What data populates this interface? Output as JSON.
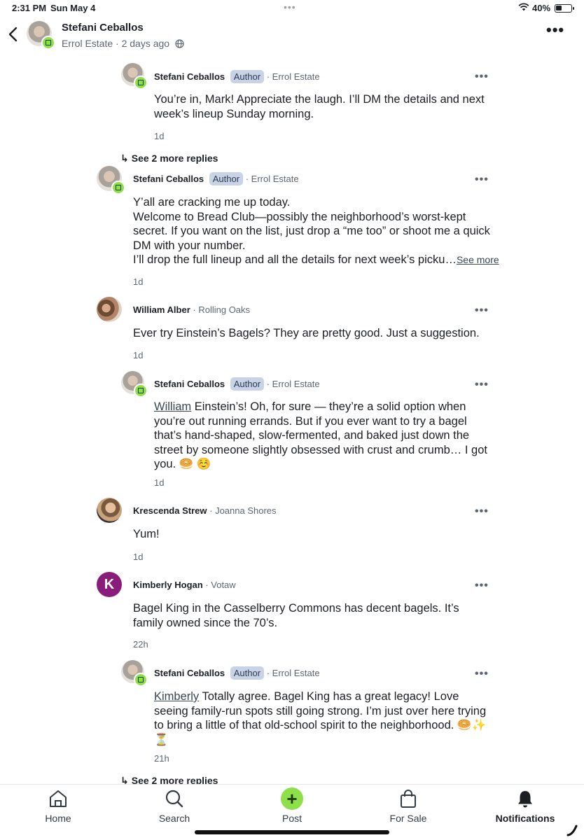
{
  "status_bar": {
    "time": "2:31 PM",
    "date": "Sun May 4",
    "battery": "40%",
    "battery_level": 0.4
  },
  "header": {
    "name": "Stefani Ceballos",
    "neighborhood": "Errol Estate",
    "age": "2 days ago"
  },
  "author_label": "Author",
  "comments": [
    {
      "name": "Stefani Ceballos",
      "location": "Errol Estate",
      "author": true,
      "mention": "",
      "text": "You’re in, Mark! Appreciate the laugh. I’ll DM the details and next week’s lineup Sunday morning.",
      "time": "1d"
    },
    {
      "name": "Stefani Ceballos",
      "location": "Errol Estate",
      "author": true,
      "mention": "",
      "lines": [
        "Y’all are cracking me up today.",
        "Welcome to Bread Club—possibly the neighborhood’s worst-kept secret. If you want on the list, just drop a “me too” or shoot me a quick DM with your number.",
        "I’ll drop the full lineup and all the details for next week’s picku…"
      ],
      "see_more": "See more",
      "time": "1d"
    },
    {
      "name": "William Alber",
      "location": "Rolling Oaks",
      "author": false,
      "mention": "",
      "text": "Ever try Einstein’s Bagels? They are pretty good. Just a suggestion.",
      "time": "1d"
    },
    {
      "name": "Stefani Ceballos",
      "location": "Errol Estate",
      "author": true,
      "mention": "William",
      "text": " Einstein’s! Oh, for sure — they’re a solid option when you’re out running errands. But if you ever want to try a bagel that’s hand-shaped, slow-fermented, and baked just down the street by someone slightly obsessed with crust and crumb… I got you. 🥯 ☺️",
      "time": "1d"
    },
    {
      "name": "Krescenda Strew",
      "location": "Joanna Shores",
      "author": false,
      "mention": "",
      "text": "Yum!",
      "time": "1d"
    },
    {
      "name": "Kimberly Hogan",
      "location": "Votaw",
      "author": false,
      "initial": "K",
      "mention": "",
      "text": "Bagel King in the Casselberry Commons has decent bagels. It’s family owned since the 70’s.",
      "time": "22h"
    },
    {
      "name": "Stefani Ceballos",
      "location": "Errol Estate",
      "author": true,
      "mention": "Kimberly",
      "text": " Totally agree. Bagel King has a great legacy! Love seeing family-run spots still going strong. I’m just over here trying to bring a little of that old-school spirit to the neighborhood. 🥯✨⏳",
      "time": "21h"
    }
  ],
  "see_replies": [
    "See 2 more replies",
    "See 2 more replies"
  ],
  "tabs": [
    {
      "label": "Home",
      "icon": "home-icon"
    },
    {
      "label": "Search",
      "icon": "search-icon"
    },
    {
      "label": "Post",
      "icon": "plus-icon"
    },
    {
      "label": "For Sale",
      "icon": "shopping-bag-icon"
    },
    {
      "label": "Notifications",
      "icon": "bell-icon",
      "active": true
    }
  ],
  "colors": {
    "accent_green": "#8ee04a",
    "author_badge": "#c9d3e6",
    "kimberly_avatar": "#8a1c7c"
  }
}
